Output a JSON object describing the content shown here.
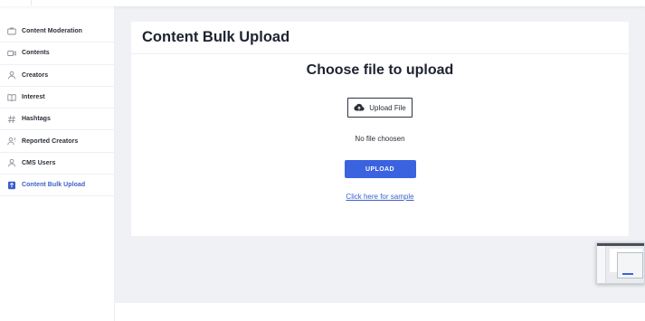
{
  "sidebar": {
    "items": [
      {
        "label": "Content Moderation",
        "icon": "content-moderation-icon",
        "active": false
      },
      {
        "label": "Contents",
        "icon": "video-icon",
        "active": false
      },
      {
        "label": "Creators",
        "icon": "person-icon",
        "active": false
      },
      {
        "label": "Interest",
        "icon": "book-icon",
        "active": false
      },
      {
        "label": "Hashtags",
        "icon": "hashtag-icon",
        "active": false
      },
      {
        "label": "Reported Creators",
        "icon": "reported-person-icon",
        "active": false
      },
      {
        "label": "CMS Users",
        "icon": "person-icon",
        "active": false
      },
      {
        "label": "Content Bulk Upload",
        "icon": "bulk-upload-icon",
        "active": true
      }
    ]
  },
  "main": {
    "page_title": "Content Bulk Upload",
    "choose_title": "Choose file to upload",
    "upload_file_label": "Upload File",
    "no_file_text": "No file choosen",
    "upload_button_label": "UPLOAD",
    "sample_link_text": "Click here for sample"
  },
  "colors": {
    "accent": "#3b63e0",
    "active_nav": "#3b5fc9",
    "background": "#f0f1f5"
  }
}
